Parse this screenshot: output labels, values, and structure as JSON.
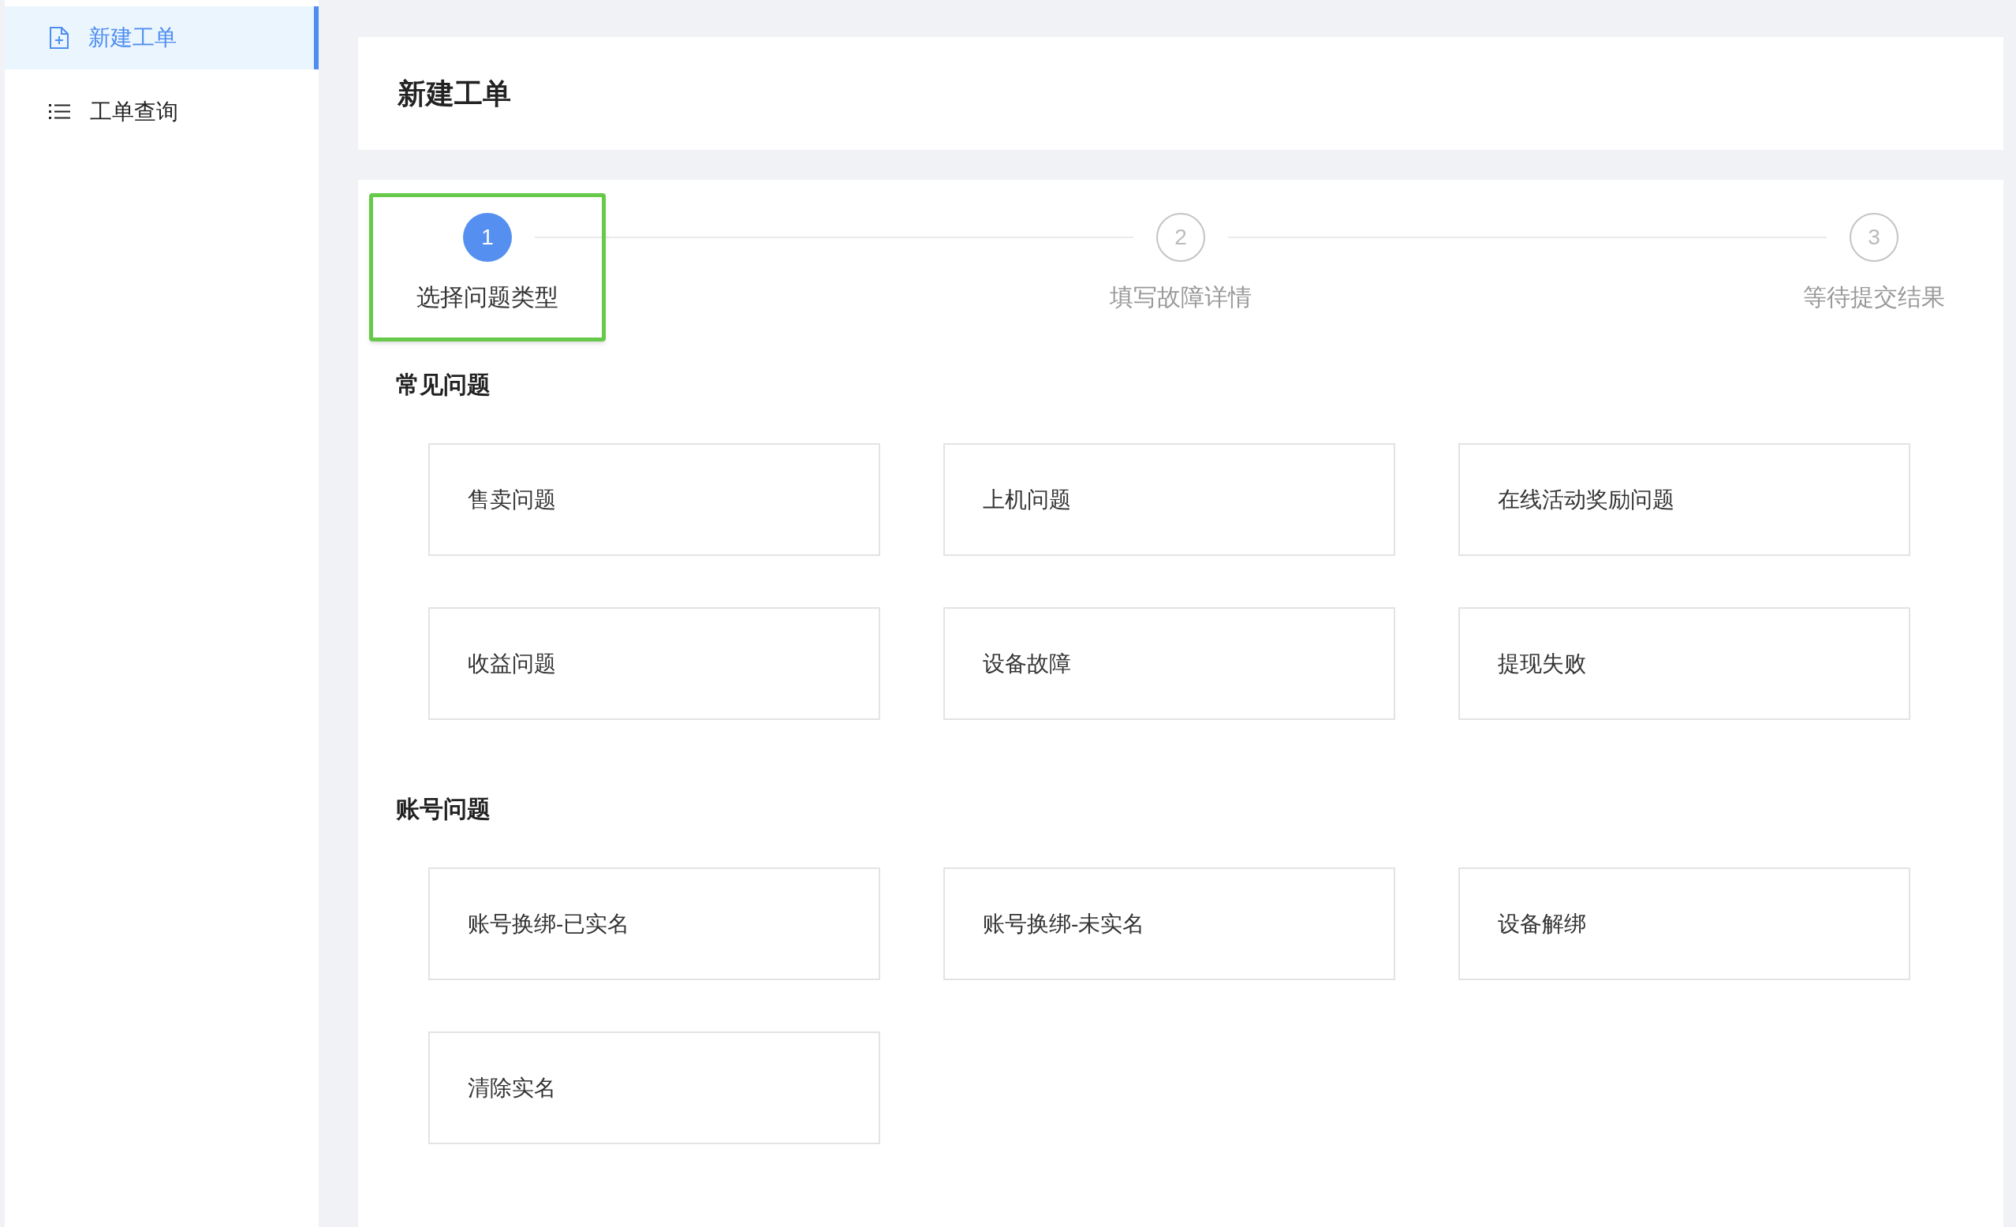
{
  "sidebar": {
    "items": [
      {
        "label": "新建工单",
        "kind": "document-plus",
        "selected": true
      },
      {
        "label": "工单查询",
        "kind": "list",
        "selected": false
      }
    ]
  },
  "page_title": "新建工单",
  "steps": [
    {
      "number": "1",
      "label": "选择问题类型",
      "active": true,
      "highlighted": true
    },
    {
      "number": "2",
      "label": "填写故障详情",
      "active": false,
      "highlighted": false
    },
    {
      "number": "3",
      "label": "等待提交结果",
      "active": false,
      "highlighted": false
    }
  ],
  "sections": [
    {
      "title": "常见问题",
      "options": [
        "售卖问题",
        "上机问题",
        "在线活动奖励问题",
        "收益问题",
        "设备故障",
        "提现失败"
      ]
    },
    {
      "title": "账号问题",
      "options": [
        "账号换绑-已实名",
        "账号换绑-未实名",
        "设备解绑",
        "清除实名"
      ]
    }
  ]
}
